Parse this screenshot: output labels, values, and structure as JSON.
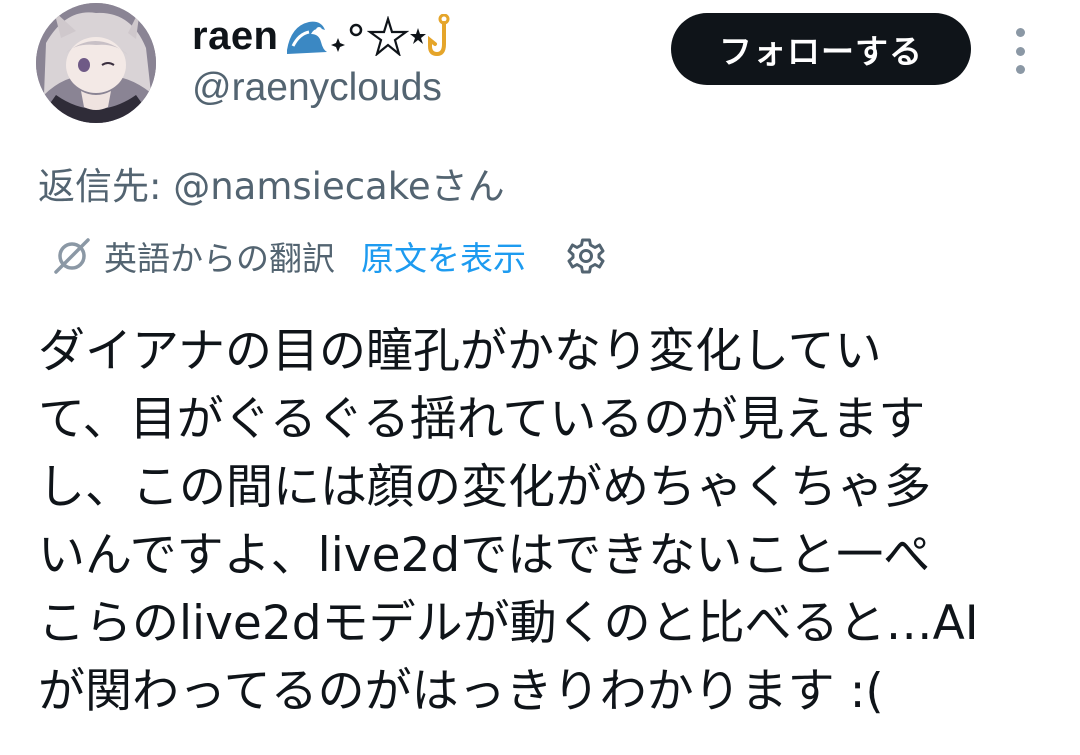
{
  "author": {
    "display_name": "raen",
    "handle": "@raenyclouds",
    "avatar_icon": "anime-character-avatar",
    "name_emoji_icons": [
      "water-wave-icon",
      "sparkle-dots-icon",
      "outline-star-icon",
      "small-star-icon",
      "hook-icon"
    ]
  },
  "actions": {
    "follow_label": "フォローする",
    "more_icon": "vertical-ellipsis-icon"
  },
  "reply": {
    "text": "返信先: @namsiecakeさん"
  },
  "translation": {
    "label": "英語からの翻訳",
    "show_original": "原文を表示",
    "icon": "translate-icon",
    "settings_icon": "gear-icon"
  },
  "tweet": {
    "lines": [
      "ダイアナの目の瞳孔がかなり変化してい",
      "て、目がぐるぐる揺れているのが見えます",
      "し、この間には顔の変化がめちゃくちゃ多",
      "いんですよ、live2dではできないこと一ぺ",
      "こらのlive2dモデルが動くのと比べると…AI",
      "が関わってるのがはっきりわかります :("
    ]
  },
  "colors": {
    "text_primary": "#0f1419",
    "text_secondary": "#536471",
    "link": "#1d9bf0",
    "button_bg": "#0f1419"
  }
}
